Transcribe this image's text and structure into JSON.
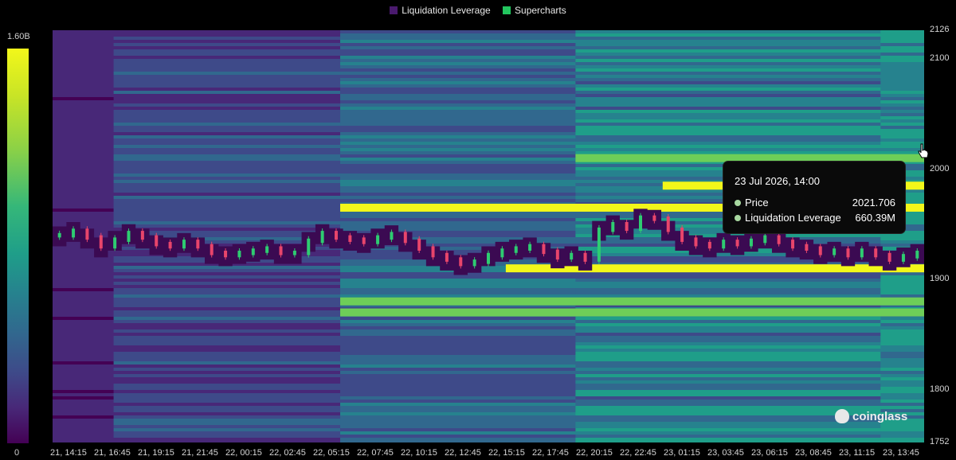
{
  "legend": {
    "items": [
      {
        "label": "Liquidation Leverage",
        "color": "#4a1a6e"
      },
      {
        "label": "Supercharts",
        "color": "#22c55e"
      }
    ]
  },
  "colorbar": {
    "max_label": "1.60B",
    "min_label": "0"
  },
  "tooltip": {
    "title": "23 Jul 2026, 14:00",
    "price_label": "Price",
    "price_value": "2021.706",
    "leverage_label": "Liquidation Leverage",
    "leverage_value": "660.39M"
  },
  "watermark": "coinglass",
  "chart_data": {
    "type": "heatmap",
    "title": "",
    "ylim": [
      1752,
      2126
    ],
    "y_ticks": [
      "2126",
      "2100",
      "2000",
      "1900",
      "1800",
      "1752"
    ],
    "x_ticks": [
      "21, 14:15",
      "21, 16:45",
      "21, 19:15",
      "21, 21:45",
      "22, 00:15",
      "22, 02:45",
      "22, 05:15",
      "22, 07:45",
      "22, 10:15",
      "22, 12:45",
      "22, 15:15",
      "22, 17:45",
      "22, 20:15",
      "22, 22:45",
      "23, 01:15",
      "23, 03:45",
      "23, 06:15",
      "23, 08:45",
      "23, 11:15",
      "23, 13:45"
    ],
    "colorscale": {
      "min": 0,
      "max": 1600000000,
      "max_label": "1.60B"
    },
    "price_series": [
      1940,
      1944,
      1938,
      1930,
      1936,
      1942,
      1938,
      1932,
      1930,
      1934,
      1930,
      1924,
      1922,
      1924,
      1926,
      1928,
      1924,
      1924,
      1935,
      1942,
      1938,
      1936,
      1934,
      1938,
      1941,
      1935,
      1928,
      1922,
      1918,
      1914,
      1916,
      1922,
      1926,
      1928,
      1930,
      1925,
      1920,
      1922,
      1918,
      1945,
      1950,
      1946,
      1956,
      1955,
      1945,
      1936,
      1932,
      1930,
      1934,
      1932,
      1935,
      1938,
      1934,
      1930,
      1928,
      1924,
      1926,
      1922,
      1926,
      1922,
      1918,
      1921,
      1924
    ],
    "liquidation_bands": [
      {
        "price": 2010,
        "intensity": 0.75,
        "from": 0.6
      },
      {
        "price": 1985,
        "intensity": 0.95,
        "from": 0.7
      },
      {
        "price": 1965,
        "intensity": 0.95,
        "from": 0.33
      },
      {
        "price": 1910,
        "intensity": 0.95,
        "from": 0.52
      },
      {
        "price": 1880,
        "intensity": 0.8,
        "from": 0.33
      },
      {
        "price": 1870,
        "intensity": 0.75,
        "from": 0.33
      }
    ]
  }
}
